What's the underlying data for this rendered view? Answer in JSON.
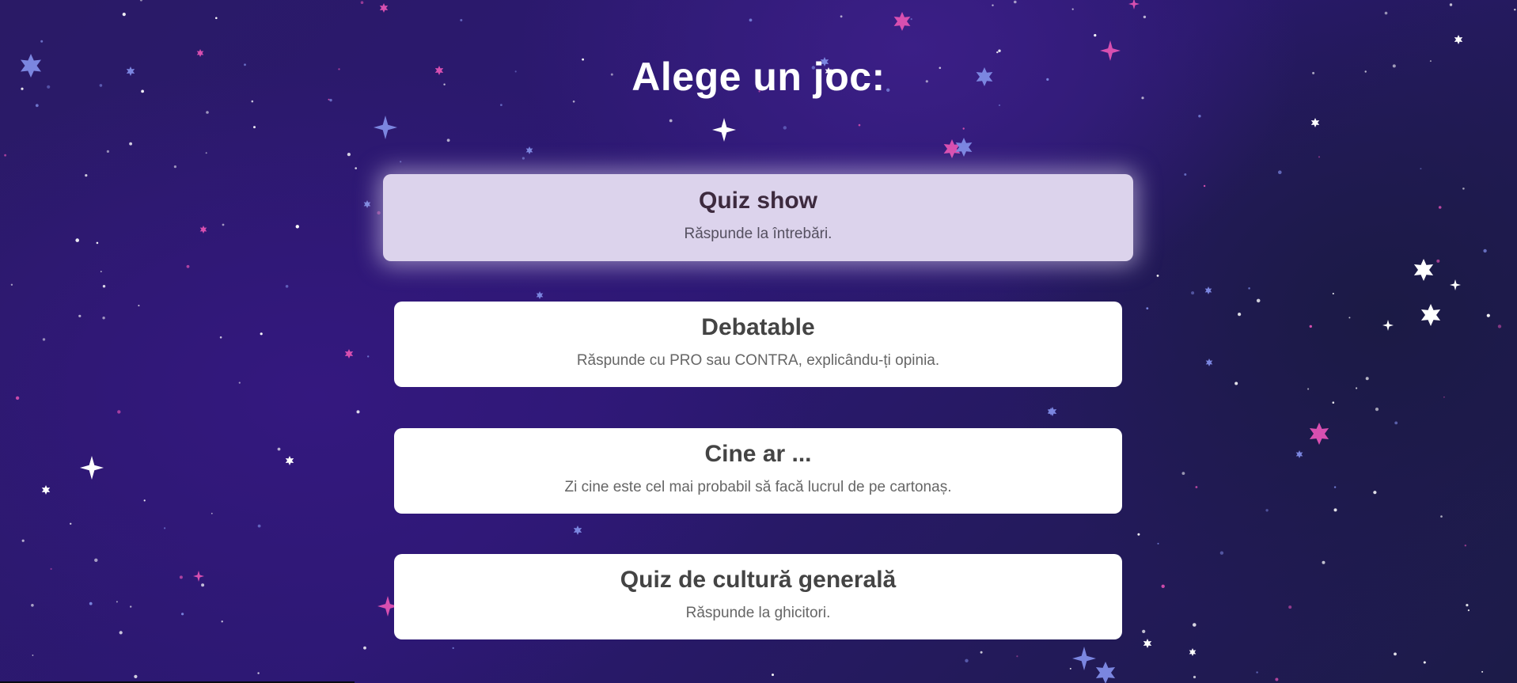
{
  "page": {
    "title": "Alege un joc:"
  },
  "games": [
    {
      "title": "Quiz show",
      "description": "Răspunde la întrebări.",
      "selected": true
    },
    {
      "title": "Debatable",
      "description": "Răspunde cu PRO sau CONTRA, explicându-ți opinia.",
      "selected": false
    },
    {
      "title": "Cine ar ...",
      "description": "Zi cine este cel mai probabil să facă lucrul de pe cartonaș.",
      "selected": false
    },
    {
      "title": "Quiz de cultură generală",
      "description": "Răspunde la ghicitori.",
      "selected": false
    }
  ],
  "theme": {
    "background": "#2c1873",
    "selected_card": "#dcd3ec",
    "card": "#ffffff",
    "star_colors": [
      "#ffffff",
      "#7b86e0",
      "#d84fb0"
    ]
  },
  "background_decoration": "starfield"
}
